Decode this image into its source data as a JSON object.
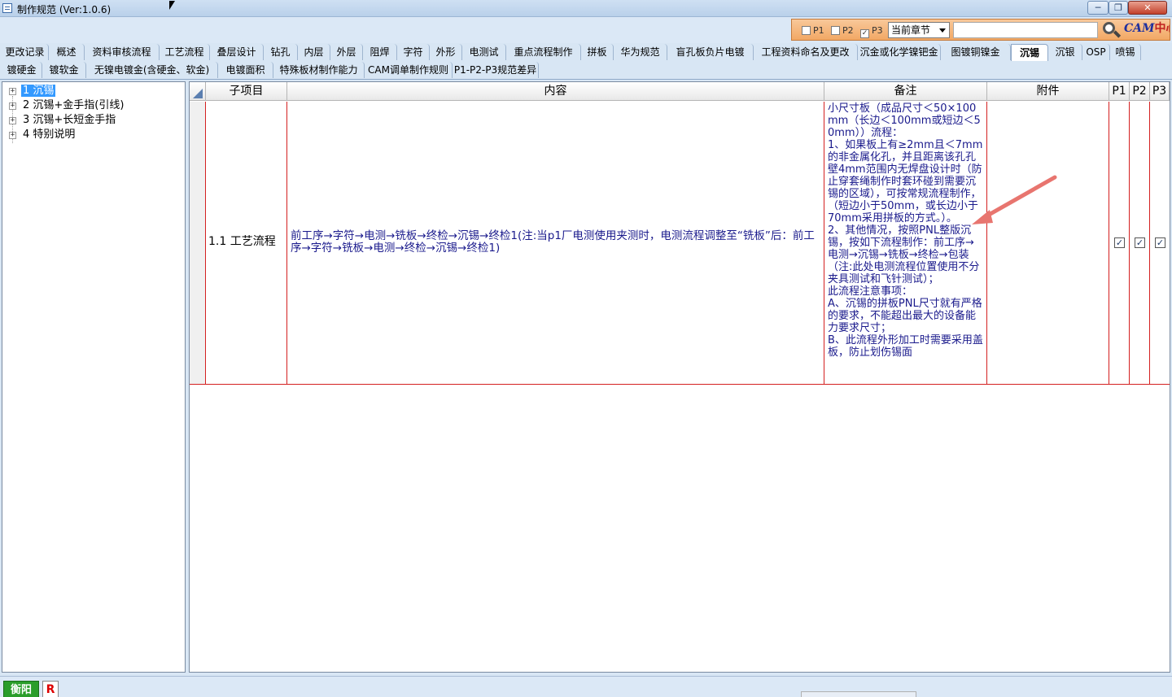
{
  "window": {
    "title": "制作规范 (Ver:1.0.6)",
    "minimize": "─",
    "restore": "❐",
    "close": "✕"
  },
  "toolbar": {
    "p1_label": "P1",
    "p2_label": "P2",
    "p3_label": "P3",
    "p1_checked": false,
    "p2_checked": false,
    "p3_checked": true,
    "scope_select": "当前章节",
    "search_value": "",
    "logo_text": "CAM",
    "logo_suffix": "中心"
  },
  "tabs_row1": [
    "更改记录",
    "概述",
    "资料审核流程",
    "工艺流程",
    "叠层设计",
    "钻孔",
    "内层",
    "外层",
    "阻焊",
    "字符",
    "外形",
    "电测试",
    "重点流程制作",
    "拼板",
    "华为规范",
    "盲孔板负片电镀",
    "工程资料命名及更改",
    "沉金或化学镍钯金",
    "图镀铜镍金",
    "沉锡",
    "沉银",
    "OSP",
    "喷锡"
  ],
  "tabs_row2": [
    "镀硬金",
    "镀软金",
    "无镍电镀金(含硬金、软金)",
    "电镀面积",
    "特殊板材制作能力",
    "CAM调单制作规则",
    "P1-P2-P3规范差异"
  ],
  "active_tab": "沉锡",
  "tree": {
    "items": [
      {
        "label": "1 沉锡",
        "selected": true
      },
      {
        "label": "2 沉锡+金手指(引线)",
        "selected": false
      },
      {
        "label": "3 沉锡+长短金手指",
        "selected": false
      },
      {
        "label": "4 特别说明",
        "selected": false
      }
    ]
  },
  "grid": {
    "headers": {
      "subitem": "子项目",
      "content": "内容",
      "remark": "备注",
      "attachment": "附件",
      "p1": "P1",
      "p2": "P2",
      "p3": "P3"
    },
    "rows": [
      {
        "subitem": "1.1 工艺流程",
        "content": "前工序→字符→电测→铣板→终检→沉锡→终检1(注:当p1厂电测使用夹测时，电测流程调整至“铣板”后：前工序→字符→铣板→电测→终检→沉锡→终检1)",
        "remark": "小尺寸板（成品尺寸＜50×100mm（长边＜100mm或短边＜50mm））流程：\n1、如果板上有≥2mm且＜7mm的非金属化孔，并且距离该孔孔壁4mm范围内无焊盘设计时（防止穿套绳制作时套环碰到需要沉锡的区域），可按常规流程制作，（短边小于50mm，或长边小于70mm采用拼板的方式。）。\n2、其他情况，按照PNL整版沉锡，按如下流程制作：前工序→电测→沉锡→铣板→终检→包装（注:此处电测流程位置使用不分夹具测试和飞针测试）；\n此流程注意事项：\nA、沉锡的拼板PNL尺寸就有严格的要求，不能超出最大的设备能力要求尺寸；\nB、此流程外形加工时需要采用盖板，防止划伤锡面",
        "attachment": "",
        "p1": true,
        "p2": true,
        "p3": true
      }
    ]
  },
  "taskbar": {
    "app1": "衡阳",
    "app2": "R"
  },
  "colors": {
    "row_border": "#d42020",
    "content_text": "#1a1a8c",
    "selection": "#3399ff",
    "arrow": "#e8756f"
  }
}
